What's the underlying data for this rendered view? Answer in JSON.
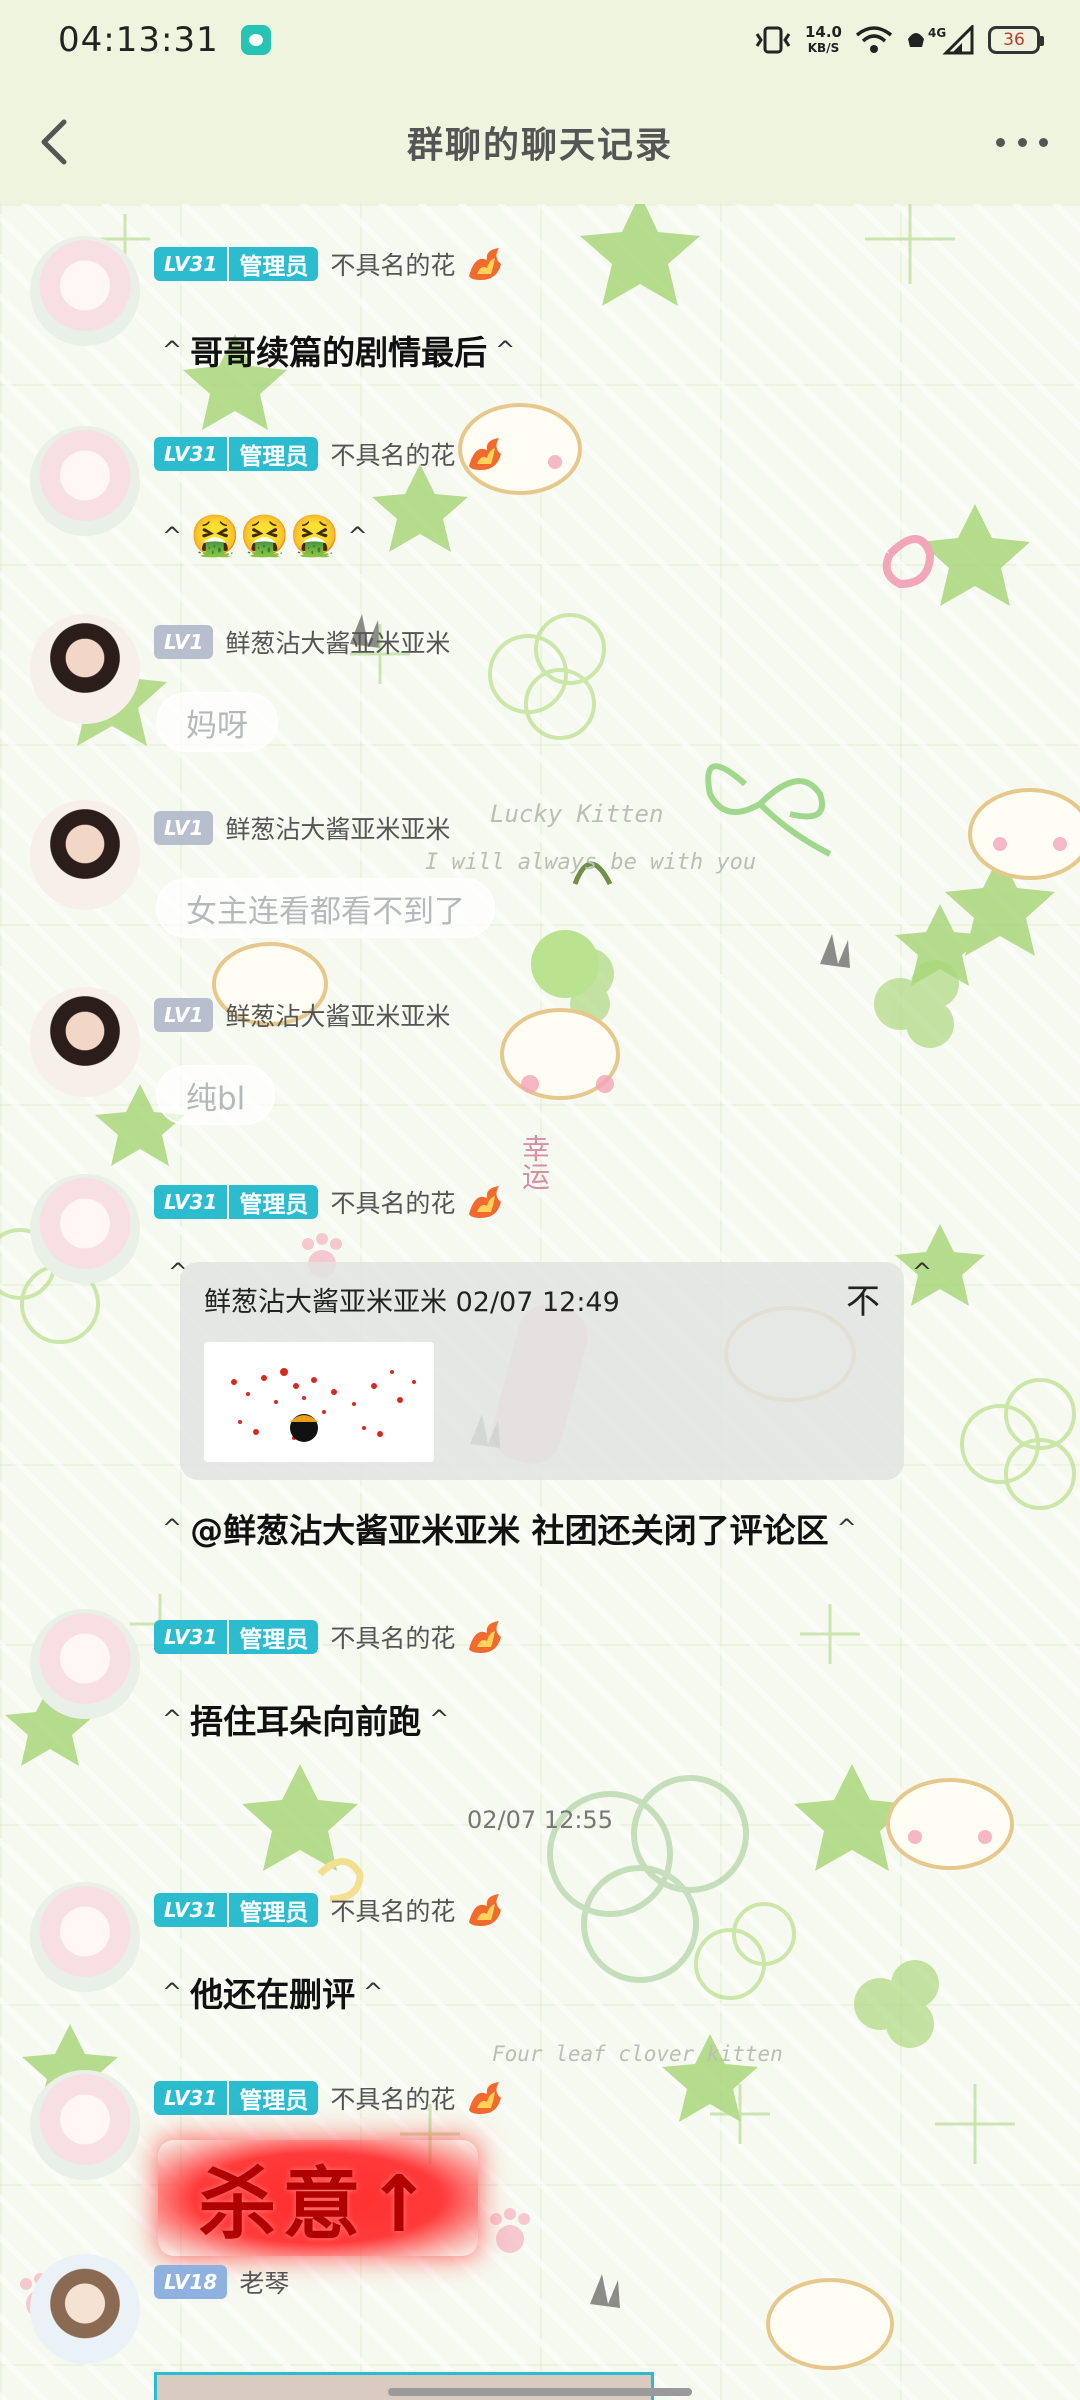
{
  "status_bar": {
    "time": "04:13:31",
    "net_speed_value": "14.0",
    "net_speed_unit": "KB/S",
    "battery": "36",
    "icons": [
      "wechat-icon",
      "vibrate-icon",
      "wifi-icon",
      "signal-4g-icon",
      "battery-icon"
    ]
  },
  "header": {
    "title": "群聊的聊天记录",
    "back_icon": "chevron-left-icon",
    "more_icon": "more-dots-icon"
  },
  "background_texts": [
    "Lucky Kitten",
    "I will always be with you",
    "Four leaf clover kitten",
    "幸运"
  ],
  "messages": [
    {
      "sender": "不具名的花",
      "level": "LV31",
      "role": "管理员",
      "text": "哥哥续篇的剧情最后"
    },
    {
      "sender": "不具名的花",
      "level": "LV31",
      "role": "管理员",
      "text": "🤮🤮🤮"
    },
    {
      "sender": "鲜葱沾大酱亚米亚米",
      "level": "LV1",
      "text": "妈呀"
    },
    {
      "sender": "鲜葱沾大酱亚米亚米",
      "level": "LV1",
      "text": "女主连看都看不到了"
    },
    {
      "sender": "鲜葱沾大酱亚米亚米",
      "level": "LV1",
      "text": "纯bl"
    },
    {
      "sender": "不具名的花",
      "level": "LV31",
      "role": "管理员",
      "quote_header": "鲜葱沾大酱亚米亚米 02/07 12:49",
      "quote_close": "不",
      "text": "@鲜葱沾大酱亚米亚米 社团还关闭了评论区"
    },
    {
      "sender": "不具名的花",
      "level": "LV31",
      "role": "管理员",
      "text": "捂住耳朵向前跑"
    },
    {
      "sender": "不具名的花",
      "level": "LV31",
      "role": "管理员",
      "text": "他还在删评"
    },
    {
      "sender": "不具名的花",
      "level": "LV31",
      "role": "管理员",
      "text": "杀意↑"
    },
    {
      "sender": "老琴",
      "level": "LV18"
    }
  ],
  "date_divider": "02/07 12:55",
  "caret": "^",
  "colors": {
    "header_bg": "#eef4dd",
    "level_badge": "#2bbcd0",
    "sticker_red": "#ff2d2d"
  }
}
